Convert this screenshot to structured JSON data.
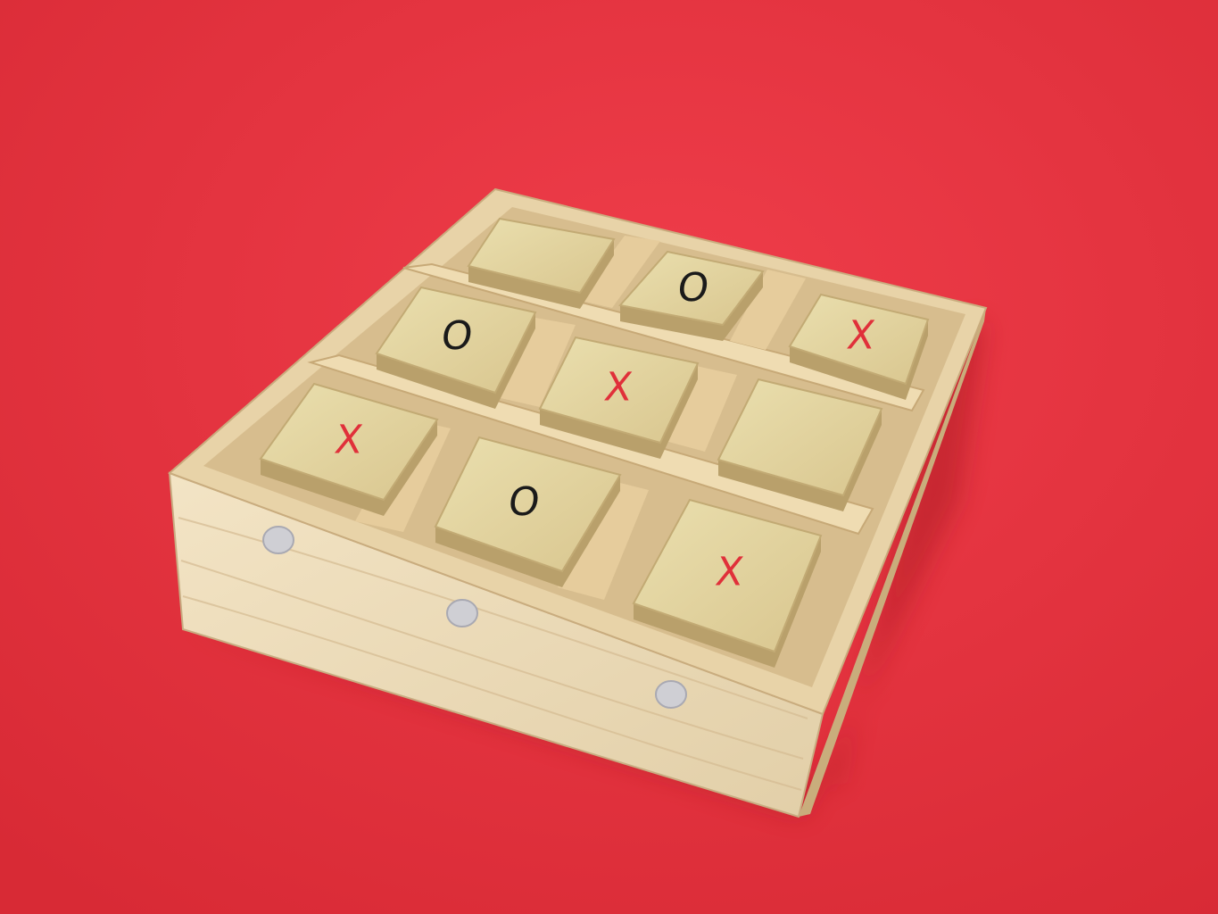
{
  "scene": {
    "background_color": "#e8323f",
    "wood_light": "#eedcb3",
    "wood_mid": "#dcc293",
    "wood_dark": "#b99a6a",
    "tile_color": "#e6d7a2",
    "x_color": "#e0303a",
    "o_color": "#1a1a1a"
  },
  "board": {
    "rows": [
      [
        "",
        "O",
        "X"
      ],
      [
        "O",
        "X",
        ""
      ],
      [
        "X",
        "O",
        "X"
      ]
    ]
  }
}
